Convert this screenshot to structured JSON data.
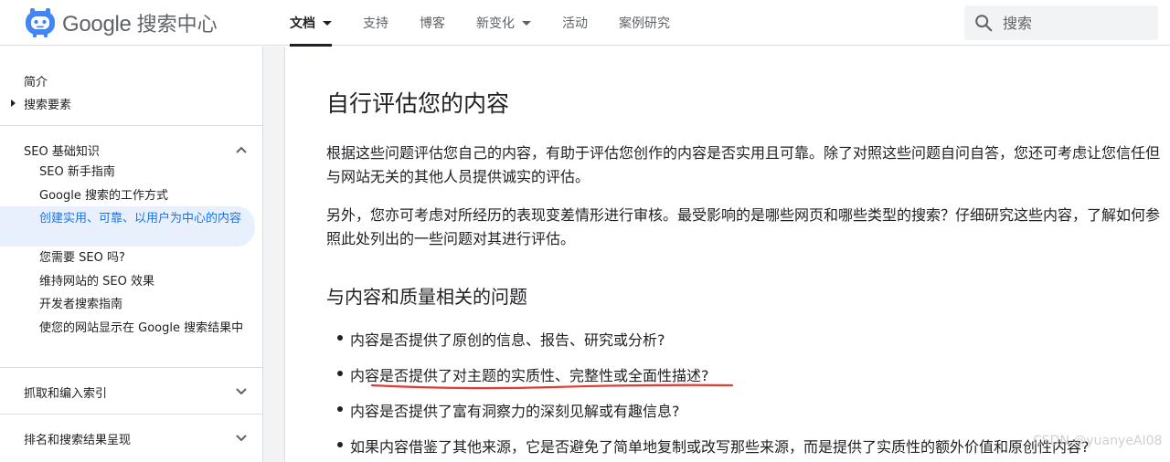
{
  "header": {
    "logo_google": "Google",
    "logo_product": "搜索中心",
    "nav": [
      {
        "label": "文档",
        "dropdown": true,
        "active": true
      },
      {
        "label": "支持"
      },
      {
        "label": "博客"
      },
      {
        "label": "新变化",
        "dropdown": true
      },
      {
        "label": "活动"
      },
      {
        "label": "案例研究"
      }
    ],
    "search_placeholder": "搜索"
  },
  "sidebar": {
    "top_items": [
      "简介",
      "搜索要素"
    ],
    "sections": [
      {
        "title": "SEO 基础知识",
        "expanded": true,
        "items": [
          "SEO 新手指南",
          "Google 搜索的工作方式",
          "创建实用、可靠、以用户为中心的内容",
          "您需要 SEO 吗?",
          "维持网站的 SEO 效果",
          "开发者搜索指南",
          "使您的网站显示在 Google 搜索结果中"
        ],
        "active_index": 2
      },
      {
        "title": "抓取和编入索引",
        "expanded": false
      },
      {
        "title": "排名和搜索结果呈现",
        "expanded": false
      }
    ]
  },
  "content": {
    "title": "自行评估您的内容",
    "paragraphs": [
      "根据这些问题评估您自己的内容，有助于评估您创作的内容是否实用且可靠。除了对照这些问题自问自答，您还可考虑让您信任但与网站无关的其他人员提供诚实的评估。",
      "另外，您亦可考虑对所经历的表现变差情形进行审核。最受影响的是哪些网页和哪些类型的搜索？仔细研究这些内容，了解如何参照此处列出的一些问题对其进行评估。"
    ],
    "subtitle": "与内容和质量相关的问题",
    "bullets": [
      "内容是否提供了原创的信息、报告、研究或分析?",
      "内容是否提供了对主题的实质性、完整性或全面性描述?",
      "内容是否提供了富有洞察力的深刻见解或有趣信息?",
      "如果内容借鉴了其他来源，它是否避免了简单地复制或改写那些来源，而是提供了实质性的额外价值和原创性内容?"
    ]
  },
  "watermark": "CSDN @yuanyeAI08",
  "colors": {
    "accent": "#1a73e8",
    "active_bg": "#e8f0fe",
    "annotation": "#e53935",
    "logo": "#4285f4"
  }
}
